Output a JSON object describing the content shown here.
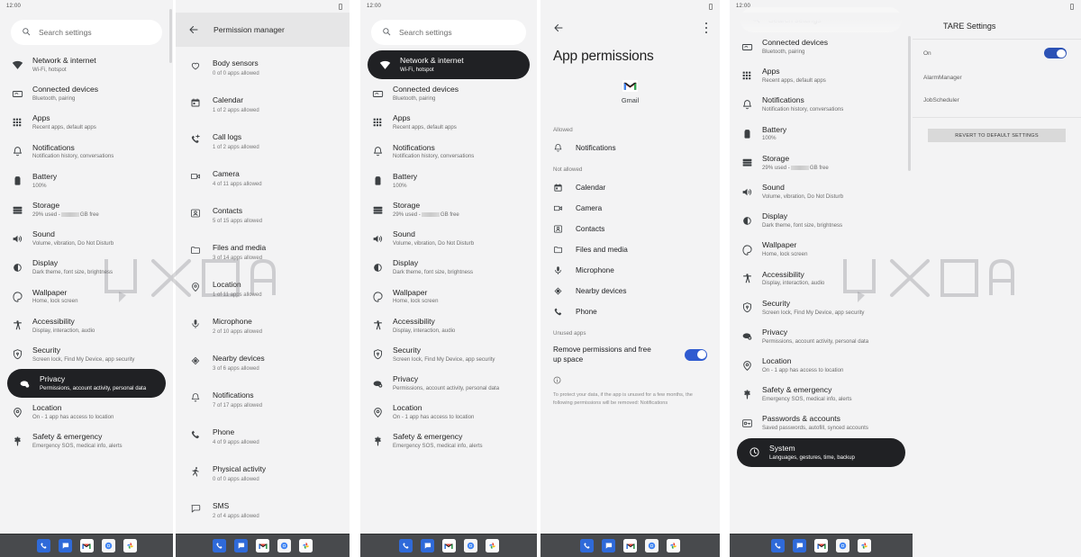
{
  "status": {
    "time": "12:00"
  },
  "search": {
    "placeholder": "Search settings",
    "icon": "search-icon"
  },
  "settings_items": [
    {
      "title": "Network & internet",
      "subtitle": "Wi-Fi, hotspot",
      "icon": "wifi-icon"
    },
    {
      "title": "Connected devices",
      "subtitle": "Bluetooth, pairing",
      "icon": "connected-devices-icon"
    },
    {
      "title": "Apps",
      "subtitle": "Recent apps, default apps",
      "icon": "apps-grid-icon"
    },
    {
      "title": "Notifications",
      "subtitle": "Notification history, conversations",
      "icon": "bell-icon"
    },
    {
      "title": "Battery",
      "subtitle": "100%",
      "icon": "battery-icon"
    },
    {
      "title": "Storage",
      "subtitle": "29% used -",
      "subtitle_suffix": "GB free",
      "icon": "storage-icon"
    },
    {
      "title": "Sound",
      "subtitle": "Volume, vibration, Do Not Disturb",
      "icon": "sound-icon"
    },
    {
      "title": "Display",
      "subtitle": "Dark theme, font size, brightness",
      "icon": "display-icon"
    },
    {
      "title": "Wallpaper",
      "subtitle": "Home, lock screen",
      "icon": "wallpaper-icon"
    },
    {
      "title": "Accessibility",
      "subtitle": "Display, interaction, audio",
      "icon": "accessibility-icon"
    },
    {
      "title": "Security",
      "subtitle": "Screen lock, Find My Device, app security",
      "icon": "security-lock-icon"
    },
    {
      "title": "Privacy",
      "subtitle": "Permissions, account activity, personal data",
      "icon": "privacy-icon"
    },
    {
      "title": "Location",
      "subtitle": "On - 1 app has access to location",
      "icon": "location-pin-icon"
    },
    {
      "title": "Safety & emergency",
      "subtitle": "Emergency SOS, medical info, alerts",
      "icon": "safety-icon"
    },
    {
      "title": "Passwords & accounts",
      "subtitle": "Saved passwords, autofill, synced accounts",
      "icon": "passwords-icon"
    },
    {
      "title": "System",
      "subtitle": "Languages, gestures, time, backup",
      "icon": "system-icon"
    }
  ],
  "panel1": {
    "name": "settings-privacy-selected",
    "selected": "Privacy"
  },
  "panel2": {
    "title": "Permission manager",
    "back_icon": "back-arrow-icon",
    "items": [
      {
        "title": "Body sensors",
        "subtitle": "0 of 0 apps allowed",
        "icon": "heart-icon"
      },
      {
        "title": "Calendar",
        "subtitle": "1 of 2 apps allowed",
        "icon": "calendar-icon"
      },
      {
        "title": "Call logs",
        "subtitle": "1 of 2 apps allowed",
        "icon": "call-logs-icon"
      },
      {
        "title": "Camera",
        "subtitle": "4 of 11 apps allowed",
        "icon": "camera-icon"
      },
      {
        "title": "Contacts",
        "subtitle": "5 of 15 apps allowed",
        "icon": "contacts-icon"
      },
      {
        "title": "Files and media",
        "subtitle": "3 of 14 apps allowed",
        "icon": "folder-icon"
      },
      {
        "title": "Location",
        "subtitle": "1 of 11 apps allowed",
        "icon": "location-pin-icon"
      },
      {
        "title": "Microphone",
        "subtitle": "2 of 10 apps allowed",
        "icon": "microphone-icon"
      },
      {
        "title": "Nearby devices",
        "subtitle": "3 of 6 apps allowed",
        "icon": "nearby-devices-icon"
      },
      {
        "title": "Notifications",
        "subtitle": "7 of 17 apps allowed",
        "icon": "bell-icon"
      },
      {
        "title": "Phone",
        "subtitle": "4 of 9 apps allowed",
        "icon": "phone-icon"
      },
      {
        "title": "Physical activity",
        "subtitle": "0 of 0 apps allowed",
        "icon": "running-icon"
      },
      {
        "title": "SMS",
        "subtitle": "2 of 4 apps allowed",
        "icon": "sms-icon"
      }
    ]
  },
  "panel3": {
    "selected": "Network & internet"
  },
  "panel4": {
    "title": "App permissions",
    "back_icon": "back-arrow-icon",
    "menu_icon": "overflow-menu-icon",
    "app_name": "Gmail",
    "app_icon": "gmail-icon",
    "allowed_label": "Allowed",
    "not_allowed_label": "Not allowed",
    "allowed": [
      {
        "title": "Notifications",
        "icon": "bell-icon"
      }
    ],
    "not_allowed": [
      {
        "title": "Calendar",
        "icon": "calendar-icon"
      },
      {
        "title": "Camera",
        "icon": "camera-icon"
      },
      {
        "title": "Contacts",
        "icon": "contacts-icon"
      },
      {
        "title": "Files and media",
        "icon": "folder-icon"
      },
      {
        "title": "Microphone",
        "icon": "microphone-icon"
      },
      {
        "title": "Nearby devices",
        "icon": "nearby-devices-icon"
      },
      {
        "title": "Phone",
        "icon": "phone-icon"
      }
    ],
    "unused_label": "Unused apps",
    "unused_toggle_label": "Remove permissions and free up space",
    "unused_toggle_on": true,
    "info_icon": "info-icon",
    "note": "To protect your data, if the app is unused for a few months, the following permissions will be removed: Notifications"
  },
  "panel5": {
    "selected": "System"
  },
  "panel6": {
    "title": "TARE Settings",
    "rows": [
      {
        "label": "On",
        "type": "toggle",
        "on": true
      },
      {
        "label": "AlarmManager",
        "type": "link"
      },
      {
        "label": "JobScheduler",
        "type": "link"
      }
    ],
    "revert_button": "REVERT TO DEFAULT SETTINGS"
  },
  "taskbar": {
    "apps": [
      {
        "name": "phone-app-icon",
        "label": "Phone"
      },
      {
        "name": "messages-app-icon",
        "label": "Messages"
      },
      {
        "name": "gmail-app-icon",
        "label": "Gmail"
      },
      {
        "name": "chrome-app-icon",
        "label": "Chrome"
      },
      {
        "name": "photos-app-icon",
        "label": "Photos"
      }
    ]
  },
  "watermark": {
    "text": "XDA"
  },
  "colors": {
    "panel_bg": "#f3f3f4",
    "selected_pill": "#202124",
    "toggle_on": "#2f5bd0",
    "taskbar": "#484a4d",
    "header_gray": "#e6e6e7"
  }
}
